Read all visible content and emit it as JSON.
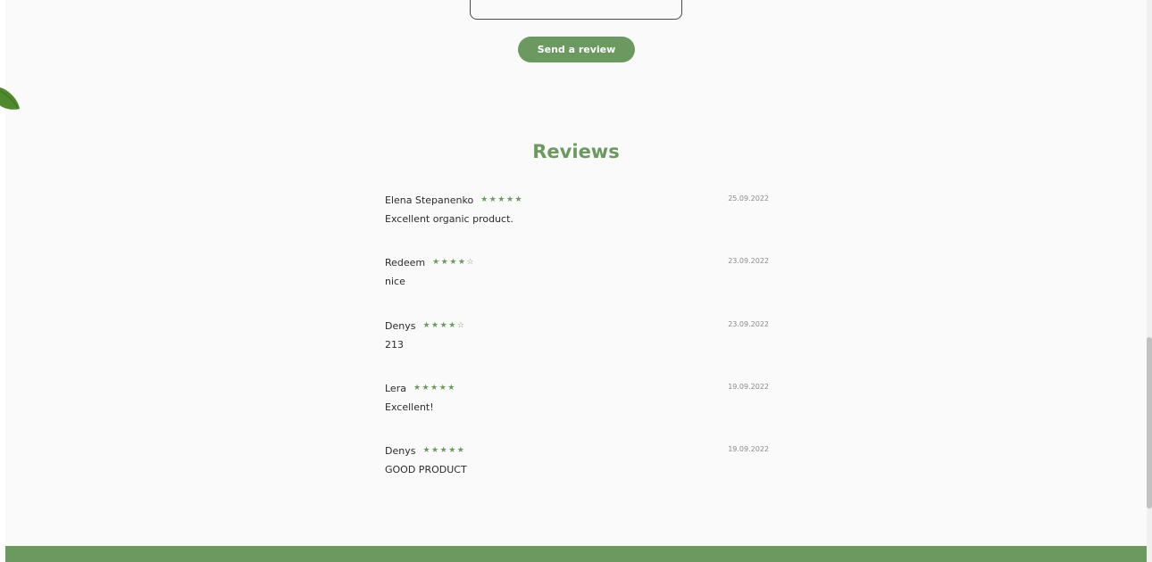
{
  "form": {
    "send_button_label": "Send a review"
  },
  "reviews_section": {
    "title": "Reviews",
    "items": [
      {
        "author": "Elena Stepanenko",
        "rating": 5,
        "max_rating": 5,
        "date": "25.09.2022",
        "text": "Excellent organic product."
      },
      {
        "author": "Redeem",
        "rating": 4,
        "max_rating": 5,
        "date": "23.09.2022",
        "text": "nice"
      },
      {
        "author": "Denys",
        "rating": 4,
        "max_rating": 5,
        "date": "23.09.2022",
        "text": "213"
      },
      {
        "author": "Lera",
        "rating": 5,
        "max_rating": 5,
        "date": "19.09.2022",
        "text": "Excellent!"
      },
      {
        "author": "Denys",
        "rating": 5,
        "max_rating": 5,
        "date": "19.09.2022",
        "text": "GOOD PRODUCT"
      }
    ]
  },
  "icons": {
    "star_filled": "star-filled-icon",
    "star_empty": "star-empty-icon",
    "leaf": "leaf-icon"
  },
  "colors": {
    "accent": "#6b9960",
    "background": "#fafafa",
    "text": "#2b2b2b",
    "date": "#8a8a8a"
  }
}
